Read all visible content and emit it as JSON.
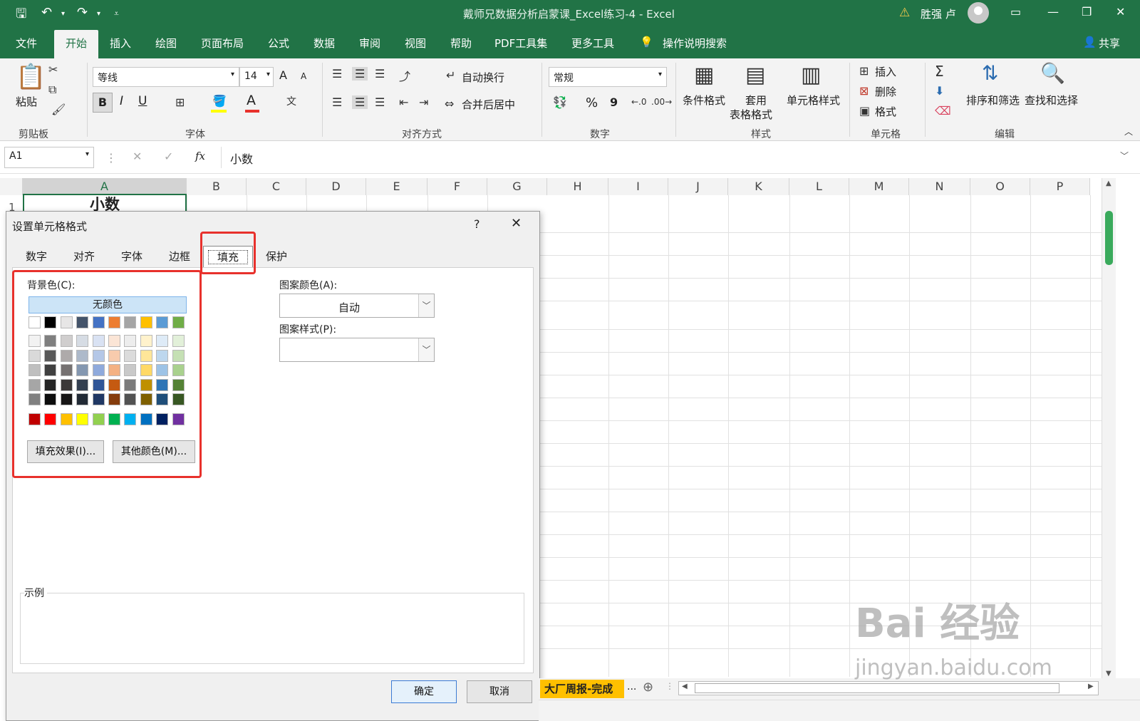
{
  "titlebar": {
    "title": "戴师兄数据分析启蒙课_Excel练习-4  -  Excel",
    "user": "胜强 卢",
    "undo_icon": "undo-icon",
    "redo_icon": "redo-icon"
  },
  "menu": {
    "tabs": [
      "文件",
      "开始",
      "插入",
      "绘图",
      "页面布局",
      "公式",
      "数据",
      "审阅",
      "视图",
      "帮助",
      "PDF工具集",
      "更多工具",
      "操作说明搜索"
    ],
    "share": "共享"
  },
  "ribbon": {
    "clipboard": {
      "label": "剪贴板",
      "paste": "粘贴"
    },
    "font": {
      "label": "字体",
      "font_name": "等线",
      "font_size": "14",
      "bold": "B",
      "italic": "I",
      "underline": "U",
      "grow": "A",
      "shrink": "A",
      "font_color_glyph": "A",
      "phonetic": "wén\n文"
    },
    "alignment": {
      "label": "对齐方式",
      "wrap": "自动换行",
      "merge": "合并后居中"
    },
    "number": {
      "label": "数字",
      "format": "常规",
      "percent": "%",
      "comma": "9"
    },
    "styles": {
      "label": "样式",
      "conditional": "条件格式",
      "table_1": "套用",
      "table_2": "表格格式",
      "cell": "单元格样式"
    },
    "cells": {
      "label": "单元格",
      "insert": "插入",
      "delete": "删除",
      "format": "格式"
    },
    "editing": {
      "label": "编辑",
      "sort": "排序和筛选",
      "find": "查找和选择"
    }
  },
  "formula_bar": {
    "name_box": "A1",
    "fx": "fx",
    "value": "小数"
  },
  "grid": {
    "columns": [
      "A",
      "B",
      "C",
      "D",
      "E",
      "F",
      "G",
      "H",
      "I",
      "J",
      "K",
      "L",
      "M",
      "N",
      "O",
      "P"
    ],
    "row1": "1",
    "a1": "小数"
  },
  "dialog": {
    "title": "设置单元格格式",
    "help": "?",
    "tabs": [
      "数字",
      "对齐",
      "字体",
      "边框",
      "填充",
      "保护"
    ],
    "selected_tab": "填充",
    "background_label": "背景色(C):",
    "no_color": "无颜色",
    "fill_effects": "填充效果(I)...",
    "more_colors": "其他颜色(M)...",
    "pattern_color_label": "图案颜色(A):",
    "pattern_color_value": "自动",
    "pattern_style_label": "图案样式(P):",
    "sample_label": "示例",
    "ok": "确定",
    "cancel": "取消",
    "palette": {
      "theme_row": [
        "#FFFFFF",
        "#000000",
        "#E7E6E6",
        "#44546A",
        "#4472C4",
        "#ED7D31",
        "#A5A5A5",
        "#FFC000",
        "#5B9BD5",
        "#70AD47"
      ],
      "tints": [
        [
          "#F2F2F2",
          "#7F7F7F",
          "#D0CECE",
          "#D6DCE4",
          "#D9E2F3",
          "#FBE5D6",
          "#EDEDED",
          "#FFF2CC",
          "#DEEBF7",
          "#E2F0D9"
        ],
        [
          "#D9D9D9",
          "#595959",
          "#AEAAAA",
          "#ADB9CA",
          "#B4C7E7",
          "#F8CBAD",
          "#DBDBDB",
          "#FFE699",
          "#BDD7EE",
          "#C5E0B4"
        ],
        [
          "#BFBFBF",
          "#404040",
          "#757171",
          "#8497B0",
          "#8FAADC",
          "#F4B183",
          "#C9C9C9",
          "#FFD966",
          "#9DC3E6",
          "#A9D18E"
        ],
        [
          "#A6A6A6",
          "#262626",
          "#3B3838",
          "#333F50",
          "#2F5597",
          "#C55A11",
          "#7B7B7B",
          "#BF9000",
          "#2E75B6",
          "#548235"
        ],
        [
          "#808080",
          "#0D0D0D",
          "#171616",
          "#222A35",
          "#203864",
          "#843C0C",
          "#525252",
          "#7F6000",
          "#1F4E79",
          "#385723"
        ]
      ],
      "standard": [
        "#C00000",
        "#FF0000",
        "#FFC000",
        "#FFFF00",
        "#92D050",
        "#00B050",
        "#00B0F0",
        "#0070C0",
        "#002060",
        "#7030A0"
      ]
    }
  },
  "sheet_tab": {
    "name": "大厂周报-完成",
    "more": "..."
  },
  "watermark": {
    "line1": "Bai 经验",
    "line2": "jingyan.baidu.com"
  }
}
